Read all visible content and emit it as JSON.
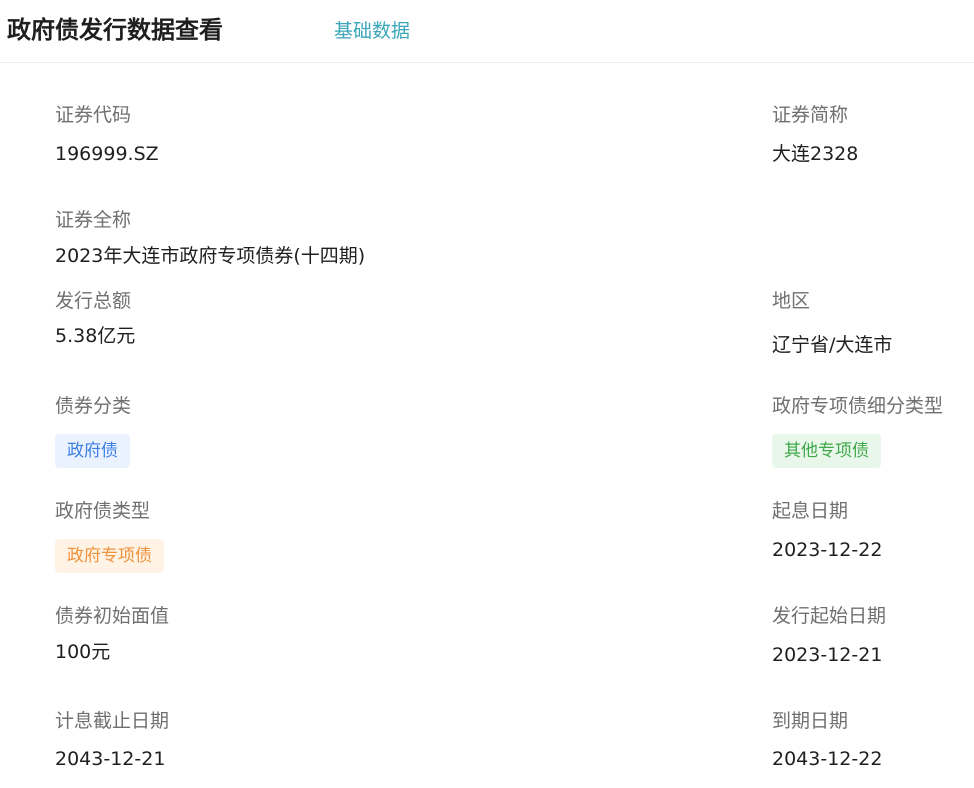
{
  "header": {
    "title": "政府债发行数据查看",
    "tab_basic": "基础数据"
  },
  "fields": {
    "code": {
      "label": "证券代码",
      "value": "196999.SZ"
    },
    "short_name": {
      "label": "证券简称",
      "value": "大连2328"
    },
    "full_name": {
      "label": "证券全称",
      "value": "2023年大连市政府专项债券(十四期)"
    },
    "total_issue": {
      "label": "发行总额",
      "value": "5.38亿元"
    },
    "region": {
      "label": "地区",
      "value": "辽宁省/大连市"
    },
    "bond_category": {
      "label": "债券分类",
      "tag": "政府债",
      "tag_color": "#3d7fe0"
    },
    "special_subtype": {
      "label": "政府专项债细分类型",
      "tag": "其他专项债",
      "tag_color": "#3ea94a"
    },
    "gov_bond_type": {
      "label": "政府债类型",
      "tag": "政府专项债",
      "tag_color": "#f0923a"
    },
    "value_date": {
      "label": "起息日期",
      "value": "2023-12-22"
    },
    "face_value": {
      "label": "债券初始面值",
      "value": "100元"
    },
    "issue_start": {
      "label": "发行起始日期",
      "value": "2023-12-21"
    },
    "interest_end": {
      "label": "计息截止日期",
      "value": "2043-12-21"
    },
    "maturity": {
      "label": "到期日期",
      "value": "2043-12-22"
    }
  }
}
